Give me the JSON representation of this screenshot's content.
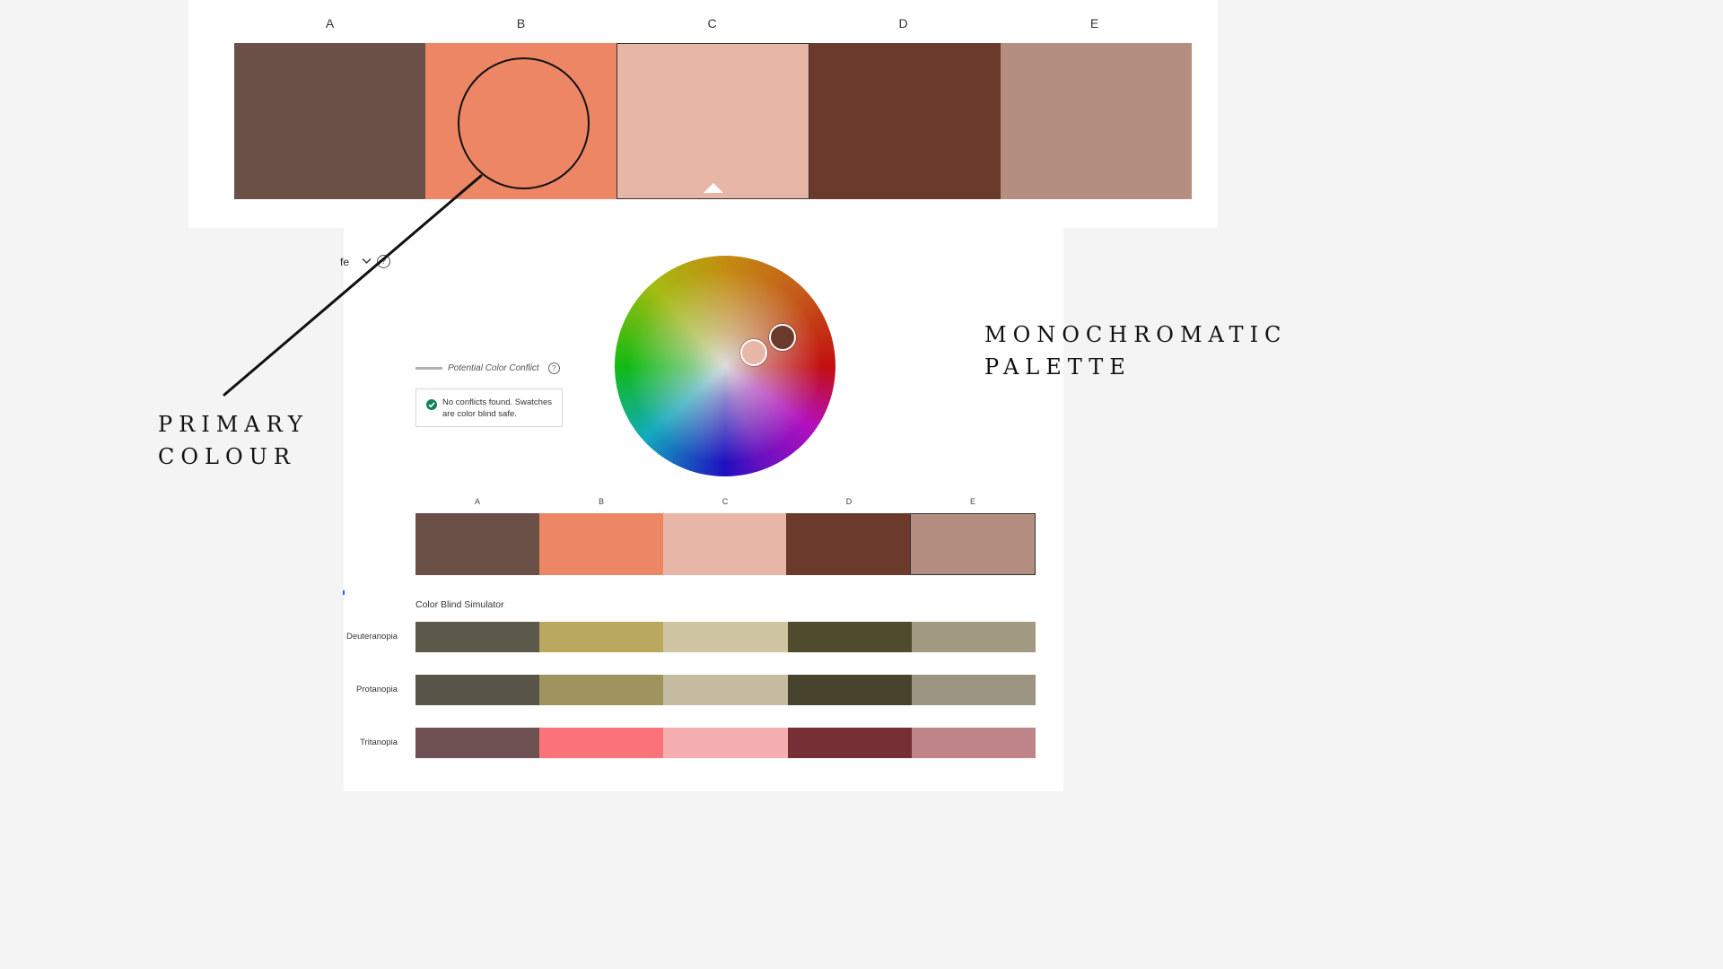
{
  "top_palette": {
    "letters": [
      "A",
      "B",
      "C",
      "D",
      "E"
    ],
    "colors": [
      "#6b5047",
      "#ec8665",
      "#e8b6a6",
      "#6b3a2c",
      "#b48f81"
    ],
    "selected": "C"
  },
  "toolbar": {
    "cut_text": "fe",
    "help": "?"
  },
  "conflict": {
    "legend_text": "Potential Color Conflict",
    "help": "?",
    "status_text": "No conflicts found. Swatches are color blind safe.",
    "status_color": "#12805c"
  },
  "wheel": {
    "handles": [
      {
        "role": "base",
        "color": "#6b3a2c"
      },
      {
        "role": "secondary",
        "color": "#e7b7a8"
      }
    ]
  },
  "main_palette": {
    "letters": [
      "A",
      "B",
      "C",
      "D",
      "E"
    ],
    "colors": [
      "#6b5047",
      "#ec8665",
      "#e8b6a6",
      "#6b3a2c",
      "#b48f81"
    ],
    "selected": "E"
  },
  "simulator": {
    "title": "Color Blind Simulator",
    "rows": [
      {
        "label": "Deuteranopia",
        "colors": [
          "#5c584a",
          "#b8a860",
          "#cfc5a3",
          "#504b2c",
          "#a19a80"
        ]
      },
      {
        "label": "Protanopia",
        "colors": [
          "#585448",
          "#a0945e",
          "#c4bba1",
          "#48432c",
          "#9b9480"
        ]
      },
      {
        "label": "Tritanopia",
        "colors": [
          "#6f5052",
          "#fc727a",
          "#f4b0b0",
          "#752f35",
          "#bf8487"
        ]
      }
    ]
  },
  "annotations": {
    "primary": [
      "PRIMARY",
      "COLOUR"
    ],
    "palette": [
      "MONOCHROMATIC",
      "PALETTE"
    ]
  }
}
